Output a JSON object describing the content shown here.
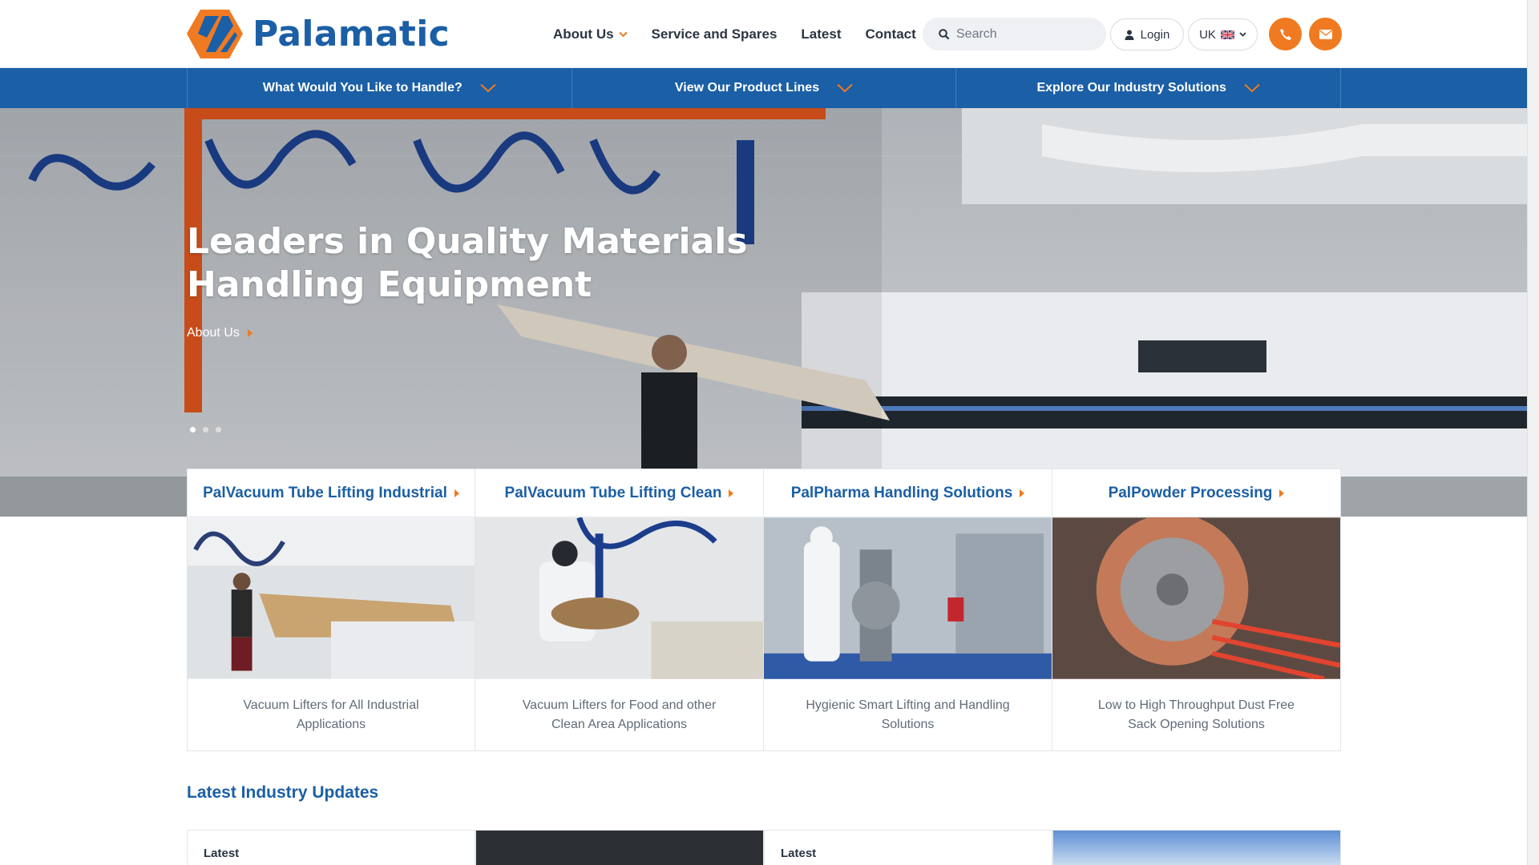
{
  "brand": {
    "name": "Palamatic",
    "accent": "#f07a21",
    "primary": "#1b5fa6"
  },
  "nav": {
    "items": [
      {
        "label": "About Us",
        "has_dropdown": true
      },
      {
        "label": "Service and Spares"
      },
      {
        "label": "Latest"
      },
      {
        "label": "Contact"
      }
    ]
  },
  "search": {
    "placeholder": "Search",
    "icon": "search-icon"
  },
  "account": {
    "login_label": "Login",
    "icon": "user-icon"
  },
  "region": {
    "label": "UK",
    "icon": "uk-flag-icon"
  },
  "contact_buttons": [
    {
      "icon": "phone-icon"
    },
    {
      "icon": "envelope-icon"
    }
  ],
  "bluebar": {
    "items": [
      {
        "label": "What Would You Like to Handle?"
      },
      {
        "label": "View Our Product Lines"
      },
      {
        "label": "Explore Our Industry Solutions"
      }
    ]
  },
  "hero": {
    "title": "Leaders in Quality Materials Handling Equipment",
    "link_label": "About Us",
    "slides_total": 3,
    "active_slide": 1
  },
  "products": [
    {
      "title": "PalVacuum Tube Lifting Industrial",
      "description": "Vacuum Lifters for All Industrial Applications"
    },
    {
      "title": "PalVacuum Tube Lifting Clean",
      "description": "Vacuum Lifters for Food and other Clean Area Applications"
    },
    {
      "title": "PalPharma Handling Solutions",
      "description": "Hygienic Smart Lifting and Handling Solutions"
    },
    {
      "title": "PalPowder Processing",
      "description": "Low to High Throughput Dust Free Sack Opening Solutions"
    }
  ],
  "updates": {
    "title": "Latest Industry Updates",
    "items": [
      {
        "label": "Latest"
      },
      {
        "label": ""
      },
      {
        "label": "Latest"
      },
      {
        "label": ""
      }
    ]
  }
}
